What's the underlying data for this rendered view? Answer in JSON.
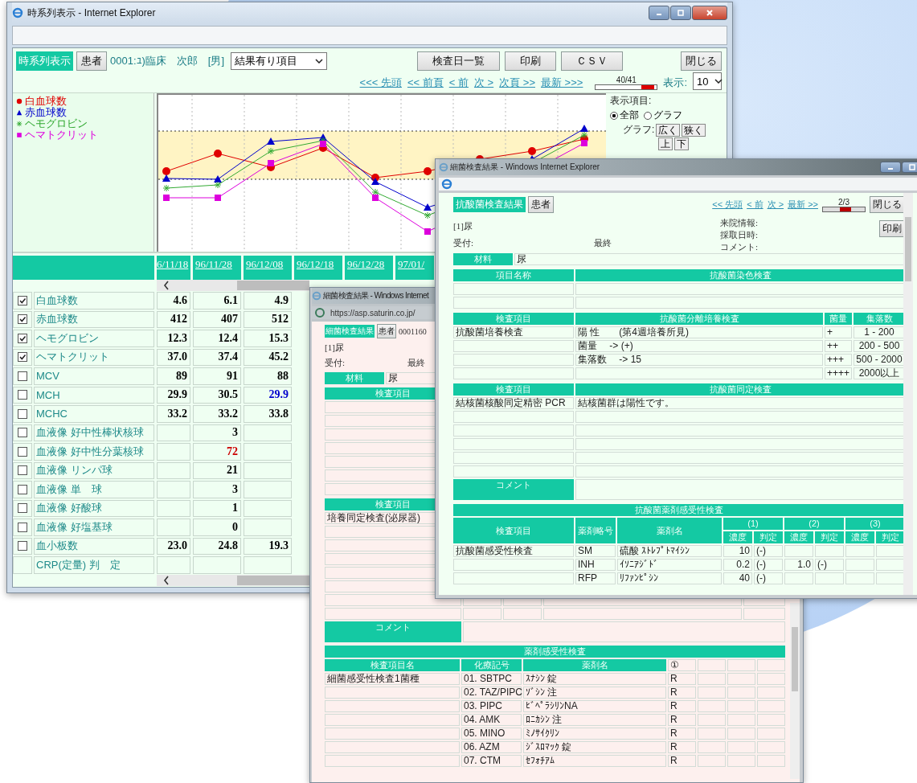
{
  "main_window": {
    "title": "時系列表示 - Internet Explorer",
    "tabs": [
      {
        "label": "時系列表示",
        "selected": true
      }
    ],
    "patient_button": "患者",
    "patient": "0001:ﾕ)臨床　次郎　[男]",
    "filter_select": "結果有り項目",
    "buttons": [
      "検査日一覧",
      "印刷",
      "ＣＳＶ"
    ],
    "close_button": "閉じる",
    "pager": {
      "links": [
        "<<< 先頭",
        "<< 前頁",
        "< 前",
        "次 >",
        "次頁 >>",
        "最新 >>>"
      ],
      "position": "40/41",
      "level": 0.95,
      "per_page_label": "表示:",
      "per_page": "10"
    },
    "legend": [
      {
        "label": "白血球数",
        "color": "#e00000",
        "kind": "circle"
      },
      {
        "label": "赤血球数",
        "color": "#0000cc",
        "kind": "triangle"
      },
      {
        "label": "ヘモグロビン",
        "color": "#33aa33",
        "kind": "asterisk"
      },
      {
        "label": "ヘマトクリット",
        "color": "#dd00dd",
        "kind": "square"
      }
    ],
    "display_panel": {
      "title": "表示項目:",
      "options": [
        {
          "label": "全部",
          "selected": true
        },
        {
          "label": "グラフ",
          "selected": false
        }
      ],
      "graph_label": "グラフ:",
      "graph_buttons": [
        "広く",
        "狭く",
        "上",
        "下"
      ]
    },
    "dates": [
      "6/11/18",
      "96/11/28",
      "96/12/08",
      "96/12/18",
      "96/12/28",
      "97/01/"
    ],
    "rows": [
      {
        "kind": "check",
        "checked": true,
        "name": "白血球数",
        "v1": {
          "text": "4.6"
        },
        "v2": {
          "text": "6.1"
        },
        "v3": {
          "text": "4.9"
        }
      },
      {
        "kind": "check",
        "checked": true,
        "name": "赤血球数",
        "v1": {
          "text": "412"
        },
        "v2": {
          "text": "407"
        },
        "v3": {
          "text": "512"
        }
      },
      {
        "kind": "check",
        "checked": true,
        "name": "ヘモグロビン",
        "v1": {
          "text": "12.3"
        },
        "v2": {
          "text": "12.4"
        },
        "v3": {
          "text": "15.3"
        }
      },
      {
        "kind": "check",
        "checked": true,
        "name": "ヘマトクリット",
        "v1": {
          "text": "37.0"
        },
        "v2": {
          "text": "37.4"
        },
        "v3": {
          "text": "45.2"
        }
      },
      {
        "kind": "check",
        "checked": false,
        "name": "MCV",
        "v1": {
          "text": "89"
        },
        "v2": {
          "text": "91"
        },
        "v3": {
          "text": "88"
        }
      },
      {
        "kind": "check",
        "checked": false,
        "name": "MCH",
        "v1": {
          "text": "29.9"
        },
        "v2": {
          "text": "30.5"
        },
        "v3": {
          "text": "29.9",
          "color": "#0000cc"
        }
      },
      {
        "kind": "check",
        "checked": false,
        "name": "MCHC",
        "v1": {
          "text": "33.2"
        },
        "v2": {
          "text": "33.2"
        },
        "v3": {
          "text": "33.8"
        }
      },
      {
        "kind": "check",
        "checked": false,
        "name": "血液像 好中性棒状核球",
        "v2": {
          "text": "3"
        }
      },
      {
        "kind": "check",
        "checked": false,
        "name": "血液像 好中性分葉核球",
        "v2": {
          "text": "72",
          "color": "#cc0000"
        }
      },
      {
        "kind": "check",
        "checked": false,
        "name": "血液像 リンパ球",
        "v2": {
          "text": "21"
        }
      },
      {
        "kind": "check",
        "checked": false,
        "name": "血液像 単　球",
        "v2": {
          "text": "3"
        }
      },
      {
        "kind": "check",
        "checked": false,
        "name": "血液像 好酸球",
        "v2": {
          "text": "1"
        }
      },
      {
        "kind": "check",
        "checked": false,
        "name": "血液像 好塩基球",
        "v2": {
          "text": "0"
        }
      },
      {
        "kind": "check",
        "checked": false,
        "name": "血小板数",
        "v1": {
          "text": "23.0"
        },
        "v2": {
          "text": "24.8"
        },
        "v3": {
          "text": "19.3"
        }
      },
      {
        "kind": "plain",
        "name": "CRP(定量) 判　定"
      }
    ]
  },
  "culture_window": {
    "title": "細菌検査結果 - Windows Internet",
    "address": "https://asp.saturin.co.jp/",
    "tabs": [
      {
        "label": "細菌検査結果",
        "selected": true
      }
    ],
    "patient_button": "患者",
    "patient_id": "0001160",
    "specimen": "[1]尿",
    "received_label": "受付:",
    "status": "最終",
    "material": {
      "label": "材料",
      "value": "尿"
    },
    "section_header": "検査項目",
    "identification": {
      "header": "検査項目",
      "rows": [
        "培養同定検査(泌尿器)"
      ]
    },
    "comment_label": "コメント",
    "susceptibility": {
      "title": "薬剤感受性検査",
      "columns": [
        "検査項目名",
        "化療記号",
        "薬剤名",
        "①"
      ],
      "rows": [
        {
          "item": "細菌感受性検査1菌種",
          "code": "01. SBTPC",
          "drug": "ｽﾅｼﾝ 錠",
          "result": "R"
        },
        {
          "code": "02. TAZ/PIPC",
          "drug": "ｿﾞｼﾝ 注",
          "result": "R"
        },
        {
          "code": "03. PIPC",
          "drug": "ﾋﾞﾍﾟﾗｼﾘﾝNA",
          "result": "R"
        },
        {
          "code": "04. AMK",
          "drug": "ﾛﾆｶｼﾝ 注",
          "result": "R"
        },
        {
          "code": "05. MINO",
          "drug": "ﾐﾉｻｲｸﾘﾝ",
          "result": "R"
        },
        {
          "code": "06. AZM",
          "drug": "ｼﾞｽﾛﾏｯｸ 錠",
          "result": "R"
        },
        {
          "code": "07. CTM",
          "drug": "ｾﾌｫﾁｱﾑ",
          "result": "R"
        }
      ]
    }
  },
  "mycobacteria_window": {
    "title": "細菌検査結果 - Windows Internet Explorer",
    "tabs": [
      {
        "label": "抗酸菌検査結果",
        "selected": true
      }
    ],
    "patient_button": "患者",
    "pager": {
      "links": [
        "<< 先頭",
        "< 前",
        "次 >",
        "最新 >>"
      ],
      "position": "2/3",
      "level": 0.67
    },
    "close_button": "閉じる",
    "print_button": "印刷",
    "specimen": "[1]尿",
    "received_label": "受付:",
    "status": "最終",
    "info_labels": [
      "来院情報:",
      "採取日時:",
      "コメント:"
    ],
    "material": {
      "label": "材料",
      "value": "尿"
    },
    "stain": {
      "columns": [
        "項目名称",
        "抗酸菌染色検査"
      ]
    },
    "culture": {
      "columns": [
        "検査項目",
        "抗酸菌分離培養検査",
        "菌量",
        "集落数"
      ],
      "rows": [
        {
          "item": "抗酸菌培養検査",
          "result": "陽 性　　(第4週培養所見)",
          "amount": "+",
          "colonies": "1 - 200"
        },
        {
          "result": "菌量　 -> (+)",
          "amount": "++",
          "colonies": "200 - 500"
        },
        {
          "result": "集落数　 -> 15",
          "amount": "+++",
          "colonies": "500 - 2000"
        },
        {
          "amount": "++++",
          "colonies": "2000以上"
        }
      ]
    },
    "identification": {
      "columns": [
        "検査項目",
        "抗酸菌同定検査"
      ],
      "rows": [
        {
          "item": "結核菌核酸同定精密 PCR",
          "result": "結核菌群は陽性です。"
        }
      ]
    },
    "comment_label": "コメント",
    "susceptibility": {
      "title": "抗酸菌薬剤感受性検査",
      "columns": [
        "検査項目",
        "薬剤略号",
        "薬剤名"
      ],
      "groups": [
        {
          "label": "(1)",
          "subcolumns": [
            "濃度",
            "判定"
          ]
        },
        {
          "label": "(2)",
          "subcolumns": [
            "濃度",
            "判定"
          ]
        },
        {
          "label": "(3)",
          "subcolumns": [
            "濃度",
            "判定"
          ]
        }
      ],
      "rows": [
        {
          "item": "抗酸菌感受性検査",
          "code": "SM",
          "drug": "硫酸 ｽﾄﾚﾌﾟﾄﾏｲｼﾝ",
          "conc_1": "10",
          "judge_1": "(-)"
        },
        {
          "code": "INH",
          "drug": "ｲｿﾆｱｼﾞﾄﾞ",
          "conc_1": "0.2",
          "judge_1": "(-)",
          "conc_2": "1.0",
          "judge_2": "(-)"
        },
        {
          "code": "RFP",
          "drug": "ﾘﾌｧﾝﾋﾟｼﾝ",
          "conc_1": "40",
          "judge_1": "(-)"
        }
      ]
    }
  }
}
